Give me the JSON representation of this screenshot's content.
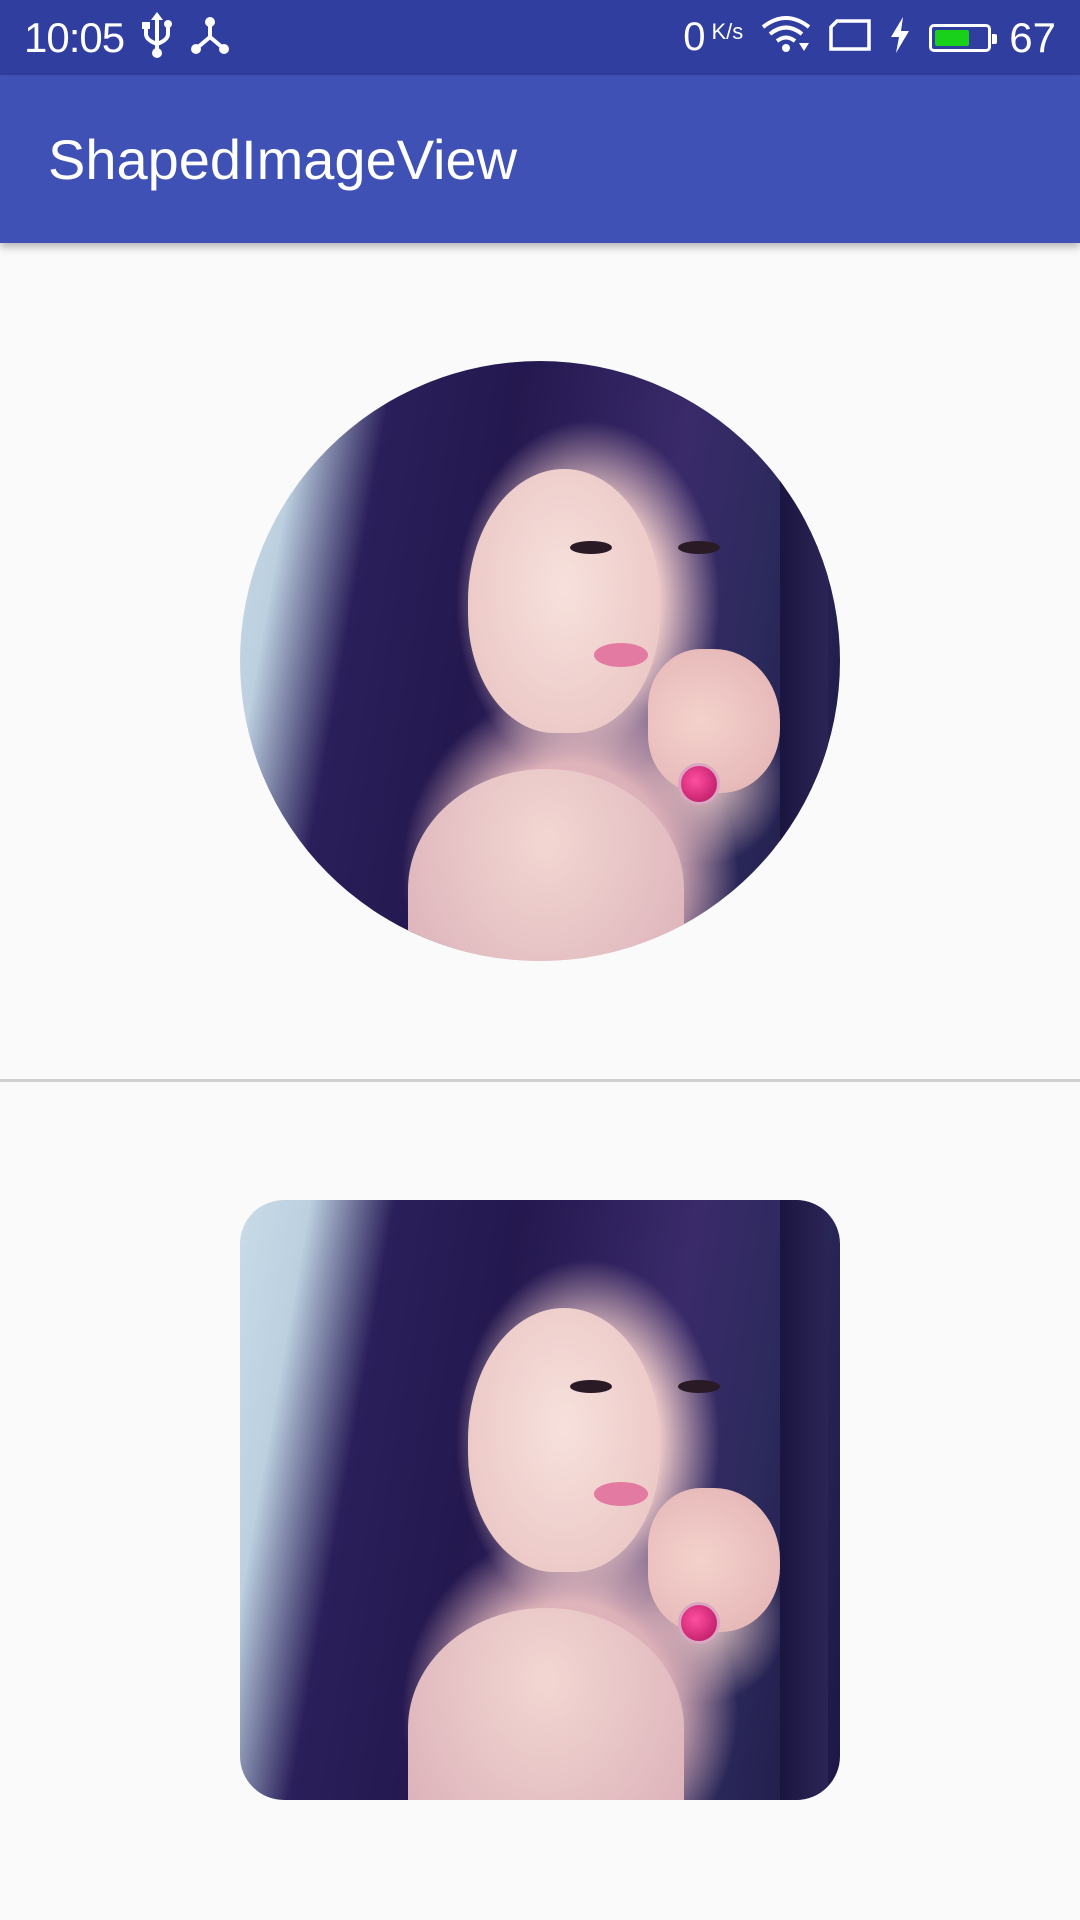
{
  "status_bar": {
    "time": "10:05",
    "left_icons": [
      "usb-icon",
      "share-icon"
    ],
    "network_speed": "0",
    "network_speed_unit": "K/s",
    "right_icons": [
      "wifi-icon",
      "screen-rotate-icon",
      "charging-icon",
      "battery-icon"
    ],
    "battery_level": 67,
    "battery_percent": "67",
    "battery_color": "#19d11a",
    "background": "#303f9f"
  },
  "app_bar": {
    "title": "ShapedImageView",
    "background": "#3f51b5"
  },
  "content": {
    "images": [
      {
        "shape": "circle",
        "subject": "portrait-photo"
      },
      {
        "shape": "rounded-rectangle",
        "subject": "portrait-photo"
      }
    ]
  }
}
